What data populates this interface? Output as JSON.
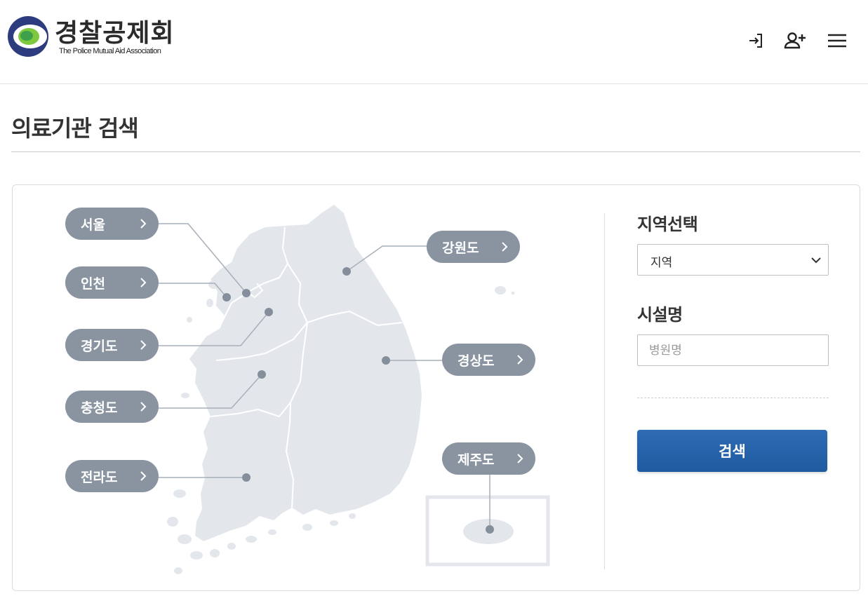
{
  "header": {
    "logo_title": "경찰공제회",
    "logo_subtitle": "The Police Mutual Aid Association",
    "icons": [
      "login-icon",
      "join-icon",
      "menu-icon"
    ]
  },
  "page": {
    "title": "의료기관 검색"
  },
  "map": {
    "regions": [
      {
        "key": "seoul",
        "label": "서울"
      },
      {
        "key": "incheon",
        "label": "인천"
      },
      {
        "key": "gyeonggi",
        "label": "경기도"
      },
      {
        "key": "chungcheong",
        "label": "충청도"
      },
      {
        "key": "jeolla",
        "label": "전라도"
      },
      {
        "key": "gangwon",
        "label": "강원도"
      },
      {
        "key": "gyeongsang",
        "label": "경상도"
      },
      {
        "key": "jeju",
        "label": "제주도"
      }
    ]
  },
  "form": {
    "region_label": "지역선택",
    "region_selected": "지역",
    "facility_label": "시설명",
    "facility_placeholder": "병원명",
    "facility_value": "",
    "search_label": "검색"
  },
  "colors": {
    "region_button": "#8994a0",
    "map_fill": "#e3e7ec",
    "search_button": "#2566ad"
  }
}
